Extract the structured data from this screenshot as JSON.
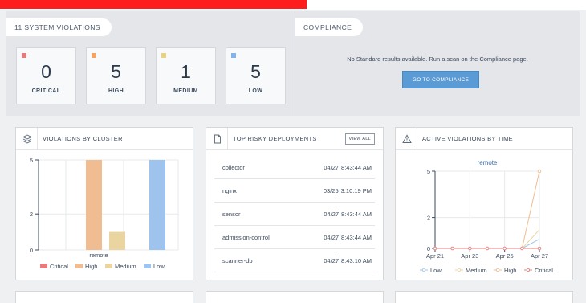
{
  "summary": {
    "title": "11 SYSTEM VIOLATIONS",
    "tiles": [
      {
        "value": "0",
        "label": "CRITICAL",
        "color": "#e57b7b"
      },
      {
        "value": "5",
        "label": "HIGH",
        "color": "#f0a468"
      },
      {
        "value": "1",
        "label": "MEDIUM",
        "color": "#ebd27e"
      },
      {
        "value": "5",
        "label": "LOW",
        "color": "#86b3e7"
      }
    ]
  },
  "compliance": {
    "title": "COMPLIANCE",
    "message": "No Standard results available. Run a scan on the Compliance page.",
    "button": "GO TO COMPLIANCE"
  },
  "cards": {
    "violations_by_cluster": {
      "title": "VIOLATIONS BY CLUSTER",
      "icon": "layers-icon"
    },
    "top_risky": {
      "title": "TOP RISKY DEPLOYMENTS",
      "icon": "document-icon",
      "view_all": "VIEW ALL",
      "rows": [
        {
          "name": "collector",
          "date": "04/27",
          "time": "8:43:44 AM"
        },
        {
          "name": "nginx",
          "date": "03/25",
          "time": "3:10:19 PM"
        },
        {
          "name": "sensor",
          "date": "04/27",
          "time": "8:43:44 AM"
        },
        {
          "name": "admission-control",
          "date": "04/27",
          "time": "8:43:44 AM"
        },
        {
          "name": "scanner-db",
          "date": "04/27",
          "time": "8:43:10 AM"
        }
      ]
    },
    "active_violations": {
      "title": "ACTIVE VIOLATIONS BY TIME",
      "icon": "warning-icon"
    }
  },
  "chart_data": [
    {
      "type": "bar",
      "categories": [
        "remote"
      ],
      "xlabel": "remote",
      "ylim": [
        0,
        5
      ],
      "yticks": [
        0,
        2,
        5
      ],
      "series": [
        {
          "name": "Critical",
          "values": [
            0
          ],
          "color": "#e57b7b"
        },
        {
          "name": "High",
          "values": [
            5
          ],
          "color": "#efbd91"
        },
        {
          "name": "Medium",
          "values": [
            1
          ],
          "color": "#ead49f"
        },
        {
          "name": "Low",
          "values": [
            5
          ],
          "color": "#9ec3ec"
        }
      ],
      "legend": "bottom"
    },
    {
      "type": "line",
      "title": "remote",
      "x": [
        "Apr 21",
        "Apr 22",
        "Apr 23",
        "Apr 24",
        "Apr 25",
        "Apr 26",
        "Apr 27"
      ],
      "xticks": [
        "Apr 21",
        "Apr 23",
        "Apr 25",
        "Apr 27"
      ],
      "ylim": [
        0,
        5
      ],
      "yticks": [
        0,
        2,
        5
      ],
      "series": [
        {
          "name": "Low",
          "values": [
            0,
            0,
            0,
            0,
            0,
            0,
            0.6
          ],
          "color": "#9ec3ec"
        },
        {
          "name": "Medium",
          "values": [
            0,
            0,
            0,
            0,
            0,
            0,
            1.2
          ],
          "color": "#ead49f"
        },
        {
          "name": "High",
          "values": [
            0,
            0,
            0,
            0,
            0,
            0,
            5
          ],
          "color": "#efbd91"
        },
        {
          "name": "Critical",
          "values": [
            0,
            0,
            0,
            0,
            0,
            0,
            0
          ],
          "color": "#e57b7b"
        }
      ],
      "legend": "bottom"
    }
  ]
}
